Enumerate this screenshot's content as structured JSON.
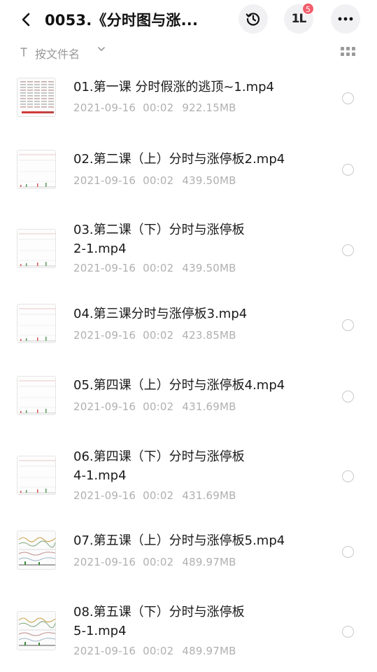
{
  "header": {
    "title": "0053.《分时图与涨...",
    "transfer_badge": "5",
    "transfer_text": "1L"
  },
  "sortbar": {
    "label": "按文件名"
  },
  "files": [
    {
      "name_line1": "01.第一课 分时假涨的逃顶~1.mp4",
      "name_line2": "",
      "date": "2021-09-16  00:02",
      "size": "922.15MB",
      "thumb": "table"
    },
    {
      "name_line1": "02.第二课（上）分时与涨停板2.mp4",
      "name_line2": "",
      "date": "2021-09-16  00:02",
      "size": "439.50MB",
      "thumb": "chart"
    },
    {
      "name_line1": "03.第二课（下）分时与涨停板",
      "name_line2": "2-1.mp4",
      "date": "2021-09-16  00:02",
      "size": "439.50MB",
      "thumb": "chart"
    },
    {
      "name_line1": "04.第三课分时与涨停板3.mp4",
      "name_line2": "",
      "date": "2021-09-16  00:02",
      "size": "423.85MB",
      "thumb": "chart"
    },
    {
      "name_line1": "05.第四课（上）分时与涨停板4.mp4",
      "name_line2": "",
      "date": "2021-09-16  00:02",
      "size": "431.69MB",
      "thumb": "chart"
    },
    {
      "name_line1": "06.第四课（下）分时与涨停板",
      "name_line2": "4-1.mp4",
      "date": "2021-09-16  00:02",
      "size": "431.69MB",
      "thumb": "chart"
    },
    {
      "name_line1": "07.第五课（上）分时与涨停板5.mp4",
      "name_line2": "",
      "date": "2021-09-16  00:02",
      "size": "489.97MB",
      "thumb": "wave"
    },
    {
      "name_line1": "08.第五课（下）分时与涨停板",
      "name_line2": "5-1.mp4",
      "date": "2021-09-16  00:02",
      "size": "489.97MB",
      "thumb": "wave"
    }
  ],
  "colors": {
    "meta": "#b0b0b0",
    "badge": "#f25d6b",
    "button_bg": "#f1f1f4"
  }
}
